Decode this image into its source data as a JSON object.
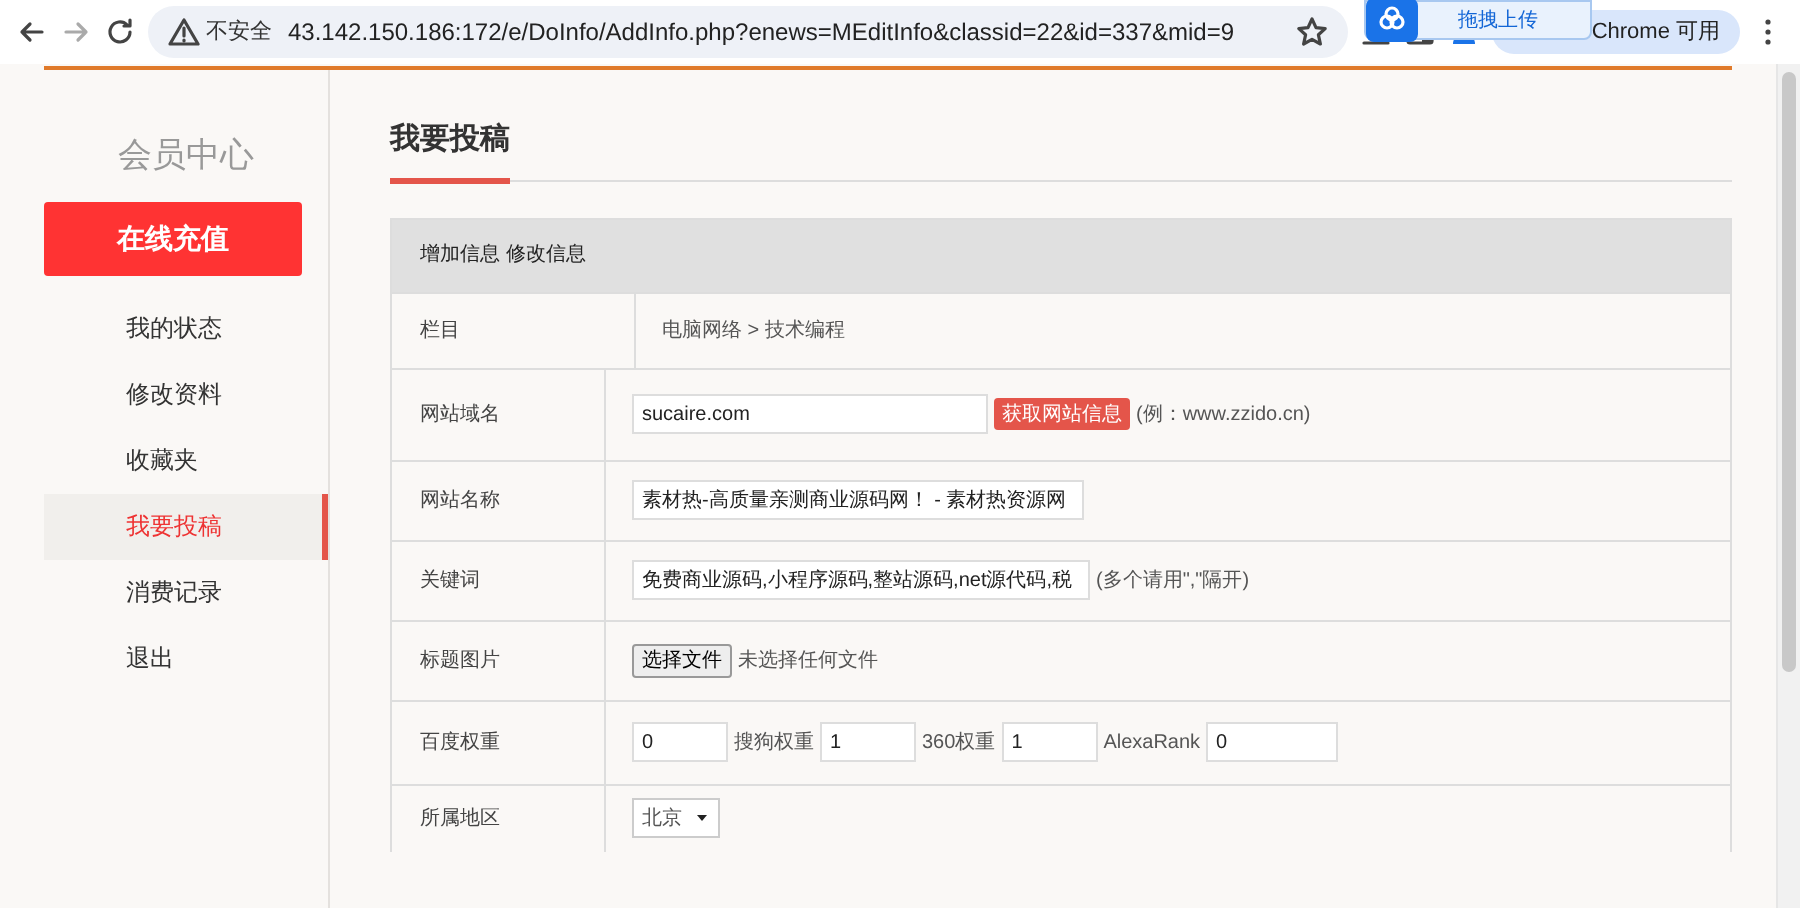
{
  "browser": {
    "security_label": "不安全",
    "url": "43.142.150.186:172/e/DoInfo/AddInfo.php?enews=MEditInfo&classid=22&id=337&mid=9",
    "update_button": "Chrome 可用",
    "popup": "拖拽上传"
  },
  "sidebar": {
    "title": "会员中心",
    "recharge_button": "在线充值",
    "items": [
      {
        "label": "我的状态",
        "selected": false
      },
      {
        "label": "修改资料",
        "selected": false
      },
      {
        "label": "收藏夹",
        "selected": false
      },
      {
        "label": "我要投稿",
        "selected": true
      },
      {
        "label": "消费记录",
        "selected": false
      },
      {
        "label": "退出",
        "selected": false
      }
    ]
  },
  "main": {
    "heading": "我要投稿",
    "form": {
      "header": "增加信息 修改信息",
      "rows": [
        {
          "kind": "text",
          "label": "栏目",
          "value": "电脑网络 > 技术编程"
        },
        {
          "kind": "input",
          "label": "网站域名",
          "value": "sucaire.com",
          "button": "获取网站信息",
          "hint": "(例：www.zzido.cn)"
        },
        {
          "kind": "input",
          "label": "网站名称",
          "value": "素材热-高质量亲测商业源码网！ - 素材热资源网"
        },
        {
          "kind": "input",
          "label": "关键词",
          "value": "免费商业源码,小程序源码,整站源码,net源代码,税",
          "hint": "(多个请用\",\"隔开)"
        },
        {
          "kind": "file",
          "label": "标题图片",
          "button": "选择文件",
          "status": "未选择任何文件"
        },
        {
          "kind": "weights",
          "label": "百度权重",
          "fields": [
            {
              "value": "0"
            },
            {
              "label": "搜狗权重",
              "value": "1"
            },
            {
              "label": "360权重",
              "value": "1"
            },
            {
              "label": "AlexaRank",
              "value": "0"
            }
          ]
        },
        {
          "kind": "select",
          "label": "所属地区",
          "value": "北京"
        }
      ]
    }
  }
}
